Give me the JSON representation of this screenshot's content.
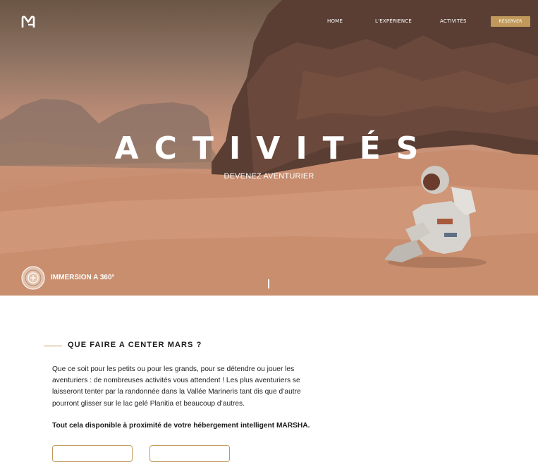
{
  "nav": {
    "home": "HOME",
    "experience": "L'EXPÉRIENCE",
    "activities": "ACTIVITÉS",
    "reserve": "RÉSERVER"
  },
  "hero": {
    "title": "ACTIVITÉS",
    "subtitle": "DEVENEZ AVENTURIER",
    "immersion": "IMMERSION A 360°"
  },
  "section": {
    "title": "QUE FAIRE A CENTER MARS ?",
    "body": "Que ce soit pour les petits ou pour les grands, pour se détendre ou jouer les aventuriers : de nombreuses activités vous attendent ! Les plus aventuriers se laisseront tenter par la randonnée dans la Vallée  Marineris tant dis que d’autre pourront glisser sur le lac gelé Planitia et beaucoup d’autres.",
    "highlight": "Tout cela disponible à proximité de votre hébergement intelligent MARSHA."
  },
  "colors": {
    "accent": "#c19a5b",
    "sand": "#c98f72",
    "rock": "#6b4a3c"
  },
  "icons": {
    "logo": "brand-logo-icon",
    "immersion": "360-view-icon"
  }
}
